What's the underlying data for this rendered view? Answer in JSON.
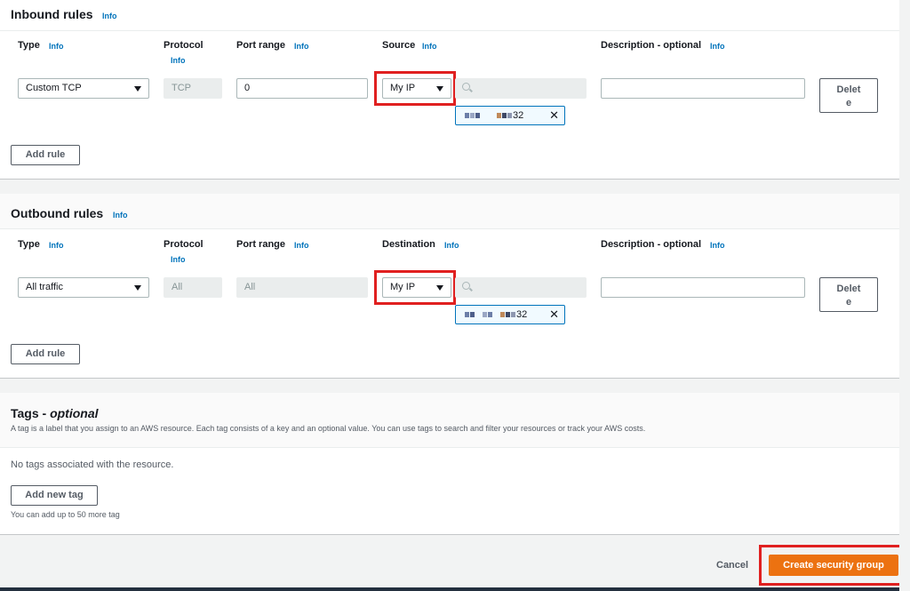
{
  "inbound": {
    "title": "Inbound rules",
    "info": "Info",
    "headers": {
      "type": "Type",
      "protocol": "Protocol",
      "port_range": "Port range",
      "source": "Source",
      "description": "Description - optional"
    },
    "row": {
      "type": "Custom TCP",
      "protocol": "TCP",
      "port_range": "0",
      "source": "My IP",
      "source_token_suffix": "32",
      "description": "",
      "delete_line1": "Delet",
      "delete_line2": "e"
    },
    "add_rule": "Add rule"
  },
  "outbound": {
    "title": "Outbound rules",
    "info": "Info",
    "headers": {
      "type": "Type",
      "protocol": "Protocol",
      "port_range": "Port range",
      "destination": "Destination",
      "description": "Description - optional"
    },
    "row": {
      "type": "All traffic",
      "protocol": "All",
      "port_range": "All",
      "destination": "My IP",
      "destination_token_suffix": "32",
      "description": "",
      "delete_line1": "Delet",
      "delete_line2": "e"
    },
    "add_rule": "Add rule"
  },
  "tags": {
    "title_main": "Tags - ",
    "title_italic": "optional",
    "description": "A tag is a label that you assign to an AWS resource. Each tag consists of a key and an optional value. You can use tags to search and filter your resources or track your AWS costs.",
    "empty": "No tags associated with the resource.",
    "add_new_tag": "Add new tag",
    "limit_note": "You can add up to 50 more tag"
  },
  "footer": {
    "cancel": "Cancel",
    "create": "Create security group"
  },
  "colors": {
    "accent": "#ec7211",
    "link": "#0073bb",
    "highlight": "#e02020"
  }
}
